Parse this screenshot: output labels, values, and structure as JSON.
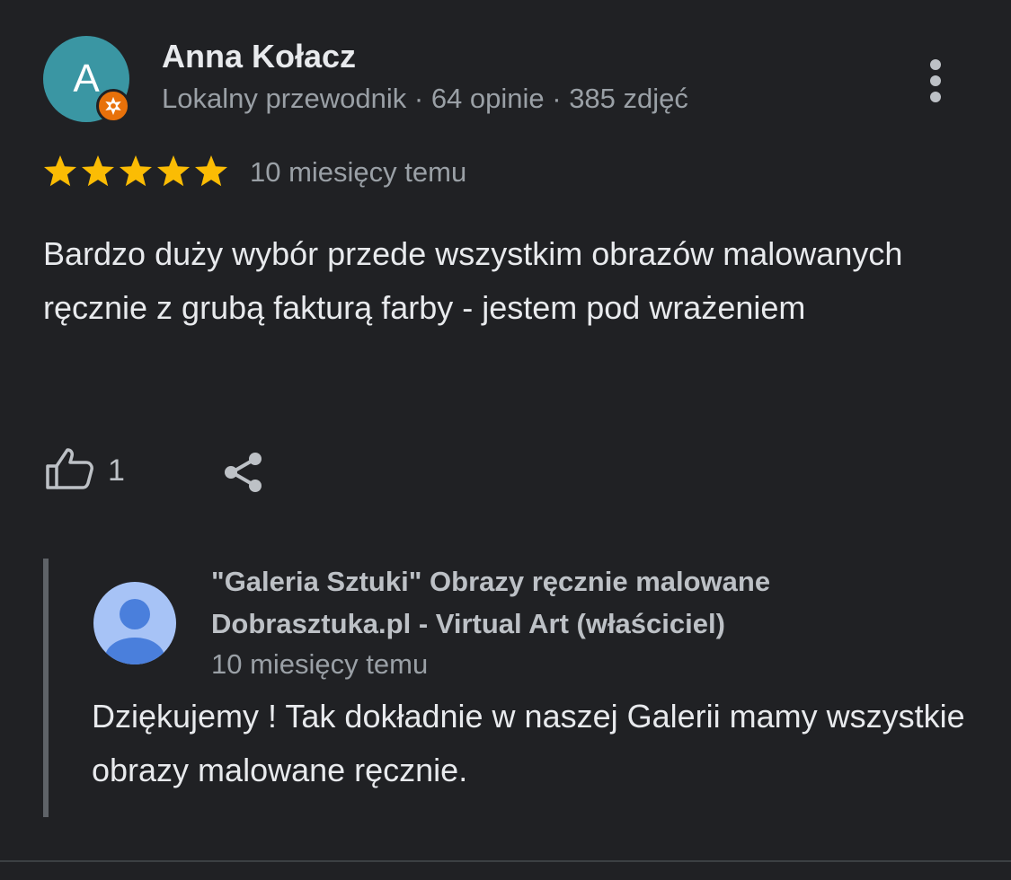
{
  "review": {
    "author": {
      "avatar_letter": "A",
      "avatar_color": "#3a96a3",
      "badge_color": "#e8710a",
      "name": "Anna Kołacz",
      "meta": "Lokalny przewodnik · 64 opinie · 385 zdjęć"
    },
    "rating": 5,
    "rating_max": 5,
    "time": "10 miesięcy temu",
    "text": "Bardzo duży wybór przede wszystkim obrazów malowanych ręcznie z grubą fakturą farby - jestem pod wrażeniem",
    "likes": "1",
    "icons": {
      "more": "more-vert-icon",
      "like": "thumb-up-icon",
      "share": "share-icon",
      "badge": "local-guide-badge-icon",
      "star": "star-icon"
    }
  },
  "owner_response": {
    "name": "\"Galeria Sztuki\" Obrazy ręcznie malowane Dobrasztuka.pl - Virtual Art (właściciel)",
    "time": "10 miesięcy temu",
    "text": "Dziękujemy ! Tak dokładnie w naszej Galerii mamy wszystkie obrazy malowane ręcznie.",
    "avatar_icon": "default-person-avatar-icon"
  },
  "colors": {
    "background": "#202124",
    "star": "#fbbc04",
    "text_primary": "#e8eaed",
    "text_secondary": "#9aa0a6"
  }
}
